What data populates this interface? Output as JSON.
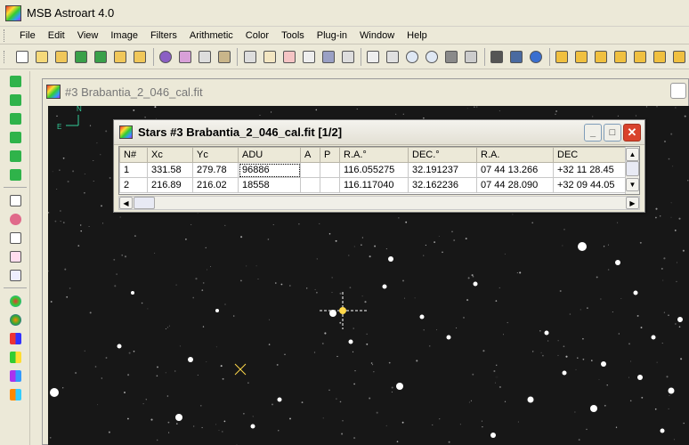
{
  "app": {
    "title": "MSB Astroart 4.0"
  },
  "menu": [
    "File",
    "Edit",
    "View",
    "Image",
    "Filters",
    "Arithmetic",
    "Color",
    "Tools",
    "Plug-in",
    "Window",
    "Help"
  ],
  "toolbar_icons": [
    "new-icon",
    "open-icon",
    "open-folder-icon",
    "save-16-icon",
    "save-8-icon",
    "save-icon",
    "folder-icon",
    "refresh-icon",
    "copy-icon",
    "duplicate-icon",
    "paste-icon",
    "preview-icon",
    "histogram-icon",
    "graph-icon",
    "star-icon",
    "display-icon",
    "sum-icon",
    "eye-icon",
    "zoom-in-icon",
    "zoom-out-icon",
    "monitor-icon",
    "window-icon",
    "binoculars-icon",
    "scope-icon",
    "help-icon",
    "plus-icon",
    "minus-icon",
    "equal-icon",
    "d-icon",
    "m-icon",
    "a-icon",
    "x-icon"
  ],
  "document": {
    "title": "#3 Brabantia_2_046_cal.fit",
    "compass_n": "N",
    "compass_e": "E"
  },
  "dialog": {
    "title": "Stars #3 Brabantia_2_046_cal.fit  [1/2]",
    "columns": [
      "N#",
      "Xc",
      "Yc",
      "ADU",
      "A",
      "P",
      "R.A.°",
      "DEC.°",
      "R.A.",
      "DEC"
    ],
    "rows": [
      [
        "1",
        "331.58",
        "279.78",
        "96886",
        "",
        "",
        "116.055275",
        "32.191237",
        "07 44 13.266",
        "+32 11 28.45"
      ],
      [
        "2",
        "216.89",
        "216.02",
        "18558",
        "",
        "",
        "116.117040",
        "32.162236",
        "07 44 28.090",
        "+32 09 44.05"
      ]
    ]
  },
  "colors": {
    "sky": "#171717",
    "marker": "#ffd84a"
  }
}
